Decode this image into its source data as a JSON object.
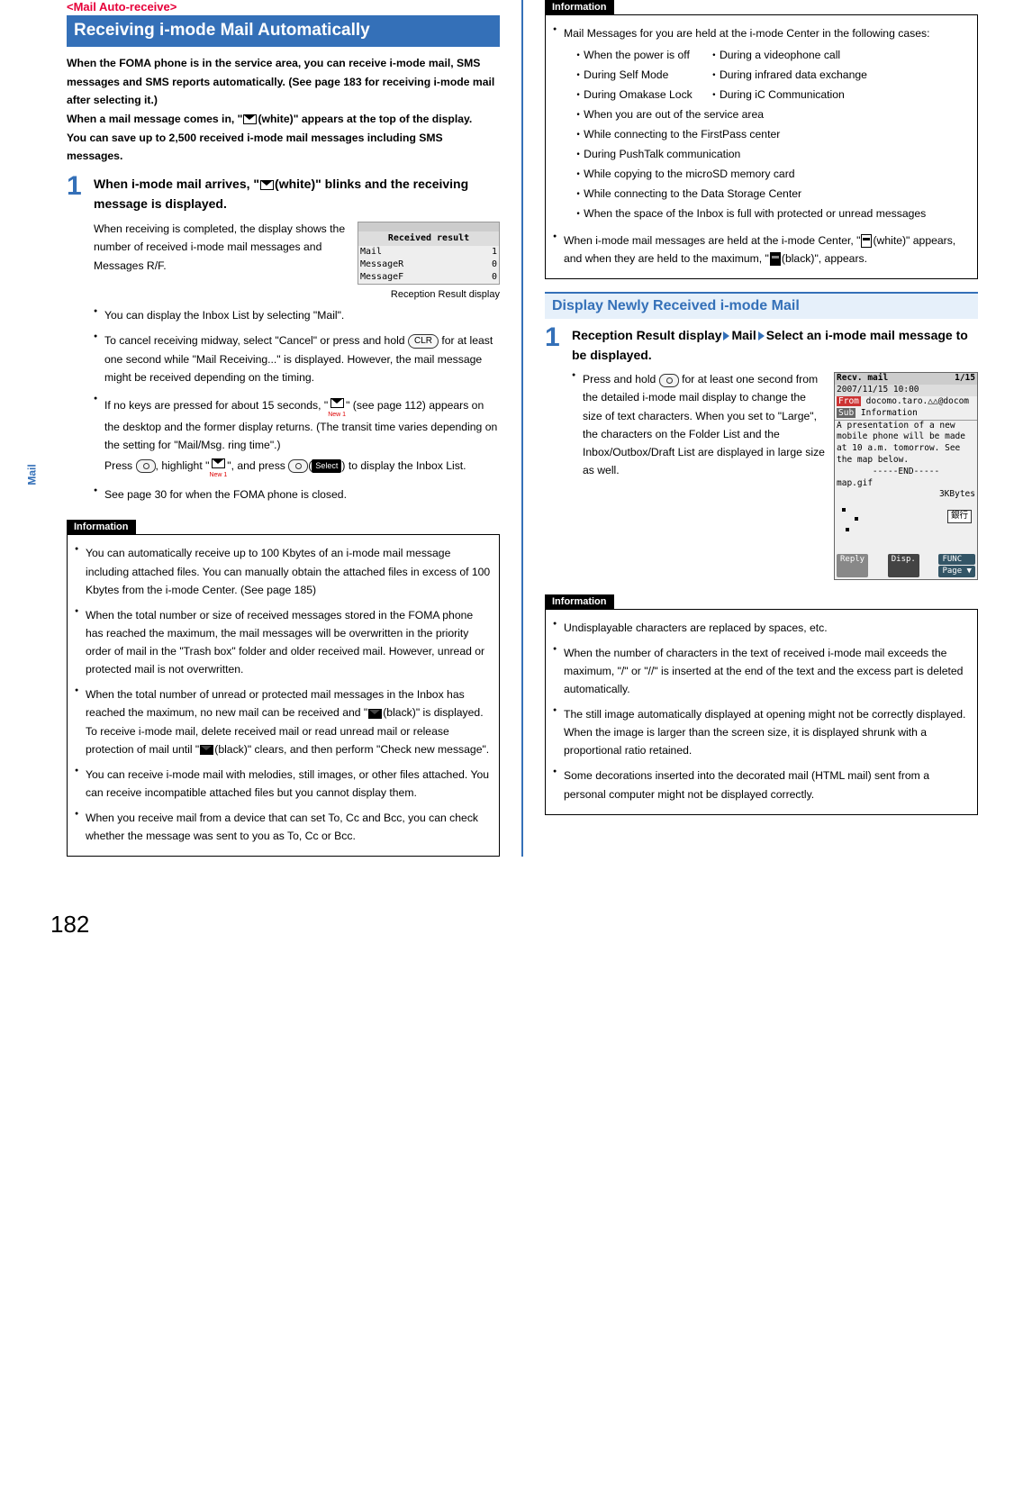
{
  "page_number": "182",
  "side_tab": "Mail",
  "left": {
    "tag": "<Mail Auto-receive>",
    "title": "Receiving i-mode Mail Automatically",
    "intro": "When the FOMA phone is in the service area, you can receive i-mode mail, SMS messages and SMS reports automatically. (See page 183 for receiving i-mode mail after selecting it.)\nWhen a mail message comes in, \" (white)\" appears at the top of the display.\nYou can save up to 2,500 received i-mode mail messages including SMS messages.",
    "step1": {
      "num": "1",
      "title_a": "When i-mode mail arrives, \"",
      "title_b": "(white)\" blinks and the receiving message is displayed.",
      "body1": "When receiving is completed, the display shows the number of received i-mode mail messages and Messages R/F.",
      "panel": {
        "header": "Received result",
        "row_mail_label": "Mail",
        "row_mail_val": "1",
        "row_r_label": "MessageR",
        "row_r_val": "0",
        "row_f_label": "MessageF",
        "row_f_val": "0"
      },
      "caption": "Reception Result display",
      "bul1": "You can display the Inbox List by selecting \"Mail\".",
      "bul2_a": "To cancel receiving midway, select \"Cancel\" or press and hold ",
      "bul2_key": "CLR",
      "bul2_b": " for at least one second while \"Mail Receiving...\" is displayed. However, the mail message might be received depending on the timing.",
      "bul3_a": "If no keys are pressed for about 15 seconds, \"",
      "bul3_new": "New 1",
      "bul3_b": "\" (see page 112) appears on the desktop and the former display returns. (The transit time varies depending on the setting for \"Mail/Msg. ring time\".)",
      "bul3_c1": "Press ",
      "bul3_c2": ", highlight \"",
      "bul3_c3": "\", and press ",
      "bul3_c4": "(",
      "bul3_chip": "Select",
      "bul3_c5": ") to display the Inbox List.",
      "bul4": "See page 30 for when the FOMA phone is closed."
    },
    "info_label": "Information",
    "info_items": [
      "You can automatically receive up to 100 Kbytes of an i-mode mail message including attached files. You can manually obtain the attached files in excess of 100 Kbytes from the i-mode Center. (See page 185)",
      "When the total number or size of received messages stored in the FOMA phone has reached the maximum, the mail messages will be overwritten in the priority order of mail in the \"Trash box\" folder and older received mail. However, unread or protected mail is not overwritten.",
      "When the total number of unread or protected mail messages in the Inbox has reached the maximum, no new mail can be received and \" (black)\" is displayed. To receive i-mode mail, delete received mail or read unread mail or release protection of mail until \" (black)\" clears, and then perform \"Check new message\".",
      "You can receive i-mode mail with melodies, still images, or other files attached. You can receive incompatible attached files but you cannot display them.",
      "When you receive mail from a device that can set To, Cc and Bcc, you can check whether the message was sent to you as To, Cc or Bcc."
    ]
  },
  "right": {
    "info_label": "Information",
    "held": {
      "lead": "Mail Messages for you are held at the i-mode Center in the following cases:",
      "col_a": [
        "・When the power is off",
        "・During Self Mode",
        "・During Omakase Lock"
      ],
      "col_b": [
        "・During a videophone call",
        "・During infrared data exchange",
        "・During iC Communication"
      ],
      "rest": [
        "・When you are out of the service area",
        "・While connecting to the FirstPass center",
        "・During PushTalk communication",
        "・While copying to the microSD memory card",
        "・While connecting to the Data Storage Center",
        "・When the space of the Inbox is full with protected or unread messages"
      ]
    },
    "center_note_a": "When i-mode mail messages are held at the i-mode Center, \"",
    "center_note_b": "(white)\" appears, and when they are held to the maximum, \"",
    "center_note_c": "(black)\", appears.",
    "h2": "Display Newly Received i-mode Mail",
    "step1": {
      "num": "1",
      "title_a": "Reception Result display",
      "title_b": "Mail",
      "title_c": "Select an i-mode mail message to be displayed.",
      "body_a": "Press and hold ",
      "body_b": " for at least one second from the detailed i-mode mail display to change the size of text characters. When you set to \"Large\", the characters on the Folder List and the Inbox/Outbox/Draft List are displayed in large size as well."
    },
    "panel2": {
      "hdr_l": "Recv. mail",
      "hdr_r": "1/15",
      "date": "2007/11/15 10:00",
      "from_lbl": "From",
      "from_val": "docomo.taro.△△@docom",
      "sub_lbl": "Sub",
      "sub_val": "Information",
      "body": "A presentation of a new mobile phone will be made at 10 a.m. tomorrow. See the map below.",
      "end": "-----END-----",
      "attach": "map.gif",
      "size": "3KBytes",
      "bank": "銀行",
      "btn_l": "Reply",
      "btn_m": "Disp.",
      "btn_r1": "FUNC",
      "btn_r2": "Page ▼"
    },
    "info2_label": "Information",
    "info2_items": [
      "Undisplayable characters are replaced by spaces, etc.",
      "When the number of characters in the text of received i-mode mail exceeds the maximum, \"/\" or \"//\" is inserted at the end of the text and the excess part is deleted automatically.",
      "The still image automatically displayed at opening might not be correctly displayed. When the image is larger than the screen size, it is displayed shrunk with a proportional ratio retained.",
      "Some decorations inserted into the decorated mail (HTML mail) sent from a personal computer might not be displayed correctly."
    ]
  }
}
